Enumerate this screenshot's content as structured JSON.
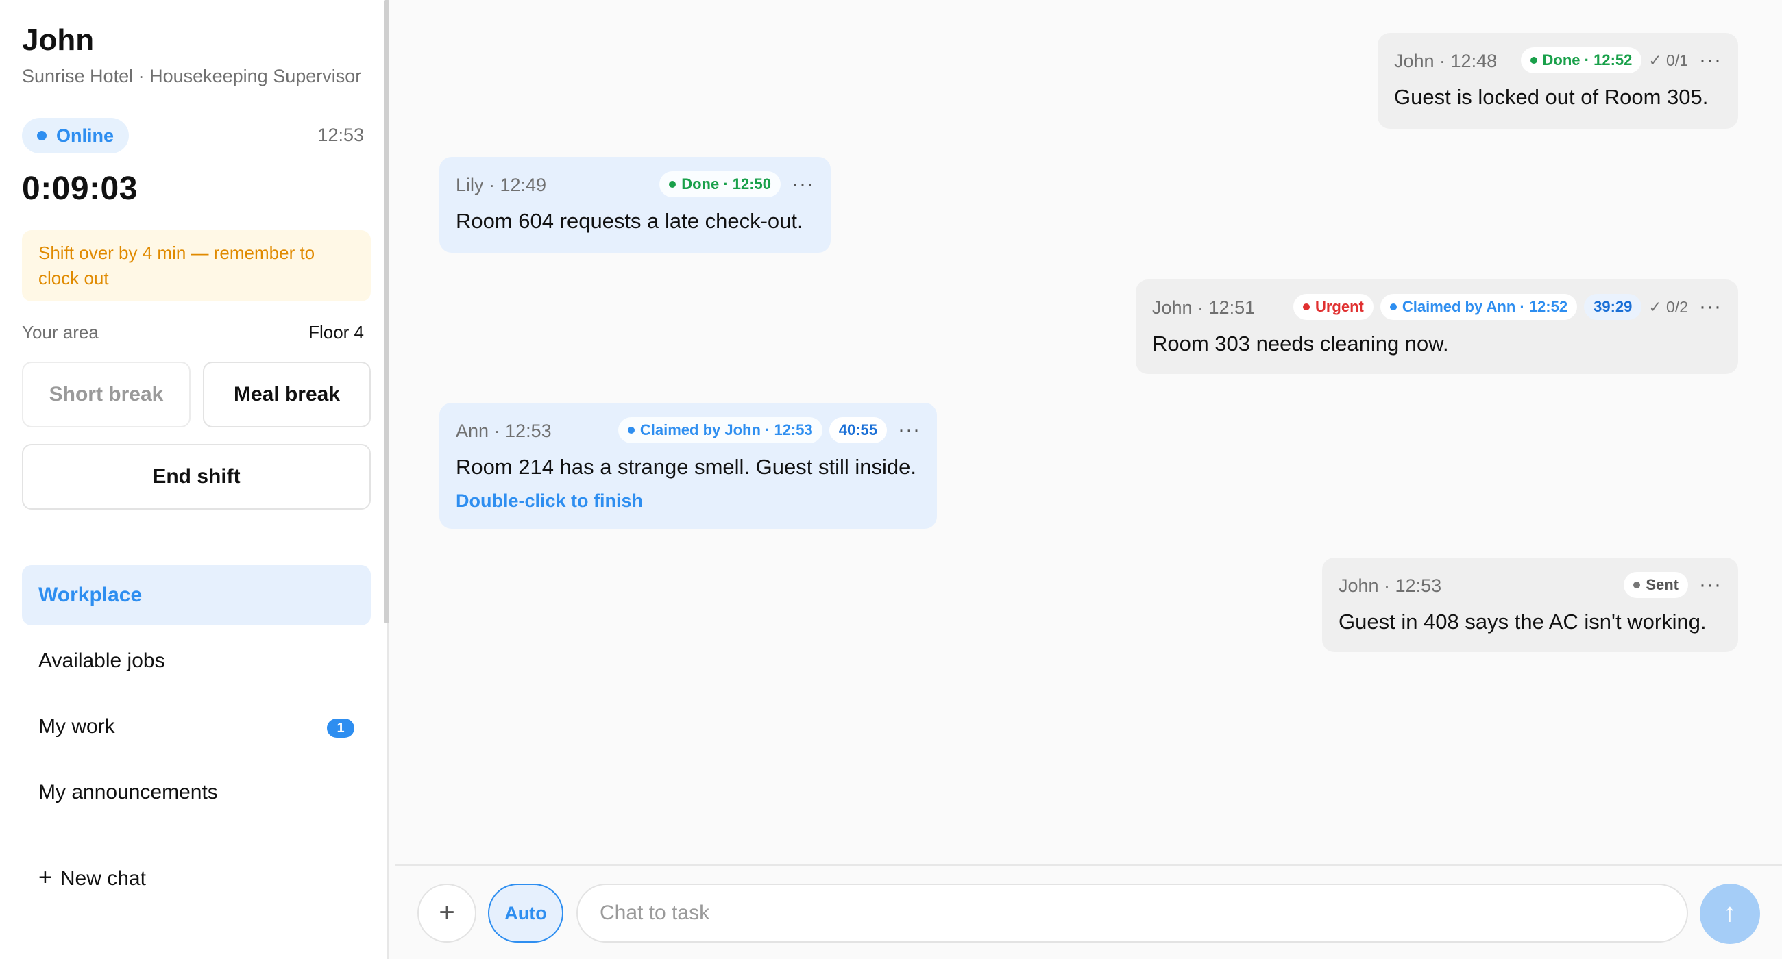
{
  "user": {
    "name": "John",
    "role": "Sunrise Hotel · Housekeeping Supervisor",
    "status": "Online",
    "clock": "12:53",
    "timer": "0:09:03",
    "warning": "Shift over by 4 min — remember to clock out",
    "area_label": "Your area",
    "area_value": "Floor 4"
  },
  "buttons": {
    "short_break": "Short break",
    "meal_break": "Meal break",
    "end_shift": "End shift"
  },
  "nav": {
    "items": [
      {
        "label": "Workplace",
        "active": true
      },
      {
        "label": "Available jobs"
      },
      {
        "label": "My work",
        "badge": "1"
      },
      {
        "label": "My announcements"
      }
    ],
    "new_chat": "New chat"
  },
  "messages": [
    {
      "author": "John · 12:48",
      "chips": [
        {
          "label": "Done · 12:52",
          "color": "green"
        }
      ],
      "count": "✓ 0/1",
      "text": "Guest is locked out of Room 305."
    },
    {
      "author": "Lily · 12:49",
      "chips": [
        {
          "label": "Done · 12:50",
          "color": "green"
        }
      ],
      "text": "Room 604 requests a late check-out."
    },
    {
      "author": "John · 12:51",
      "chips": [
        {
          "label": "Urgent",
          "color": "red"
        },
        {
          "label": "Claimed by Ann · 12:52",
          "color": "blue"
        },
        {
          "label": "39:29",
          "color": "timer"
        }
      ],
      "count": "✓ 0/2",
      "text": "Room 303 needs cleaning now."
    },
    {
      "author": "Ann · 12:53",
      "chips": [
        {
          "label": "Claimed by John · 12:53",
          "color": "blue"
        },
        {
          "label": "40:55",
          "color": "timer"
        }
      ],
      "text": "Room 214 has a strange smell. Guest still inside.",
      "link": "Double-click to finish"
    },
    {
      "author": "John · 12:53",
      "chips": [
        {
          "label": "Sent",
          "color": "gray"
        }
      ],
      "text": "Guest in 408 says the AC isn't working."
    }
  ],
  "composer": {
    "auto_label": "Auto",
    "placeholder": "Chat to task"
  },
  "colors": {
    "accent": "#2e8ef0",
    "done": "#19a04a",
    "urgent": "#e03030",
    "warning": "#e08a00"
  }
}
